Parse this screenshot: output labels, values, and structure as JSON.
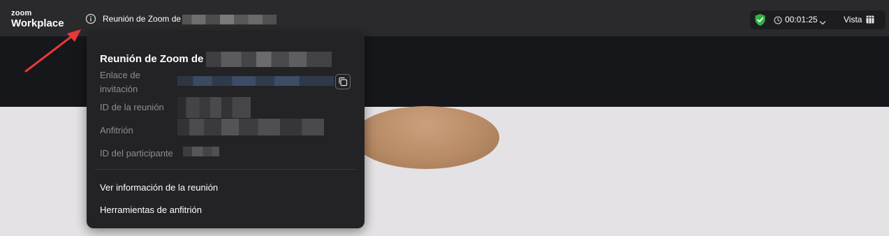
{
  "app": {
    "logo_small": "zoom",
    "logo_big": "Workplace"
  },
  "header": {
    "meeting_title_prefix": "Reunión de Zoom de",
    "timer": "00:01:25",
    "view_label": "Vista",
    "icons": {
      "info": "info-icon",
      "security": "shield-check-icon",
      "clock": "clock-icon",
      "view": "grid-icon"
    },
    "colors": {
      "security_green": "#2fb344",
      "accent_red": "#e8383a"
    }
  },
  "popover": {
    "title_prefix": "Reunión de Zoom de",
    "fields": {
      "invite_label": "Enlace de invitación",
      "meeting_id_label": "ID de la reunión",
      "host_label": "Anfitrión",
      "participant_id_label": "ID del participante"
    },
    "menu": [
      {
        "label": "Ver información de la reunión"
      },
      {
        "label": "Herramientas de anfitrión"
      }
    ]
  }
}
